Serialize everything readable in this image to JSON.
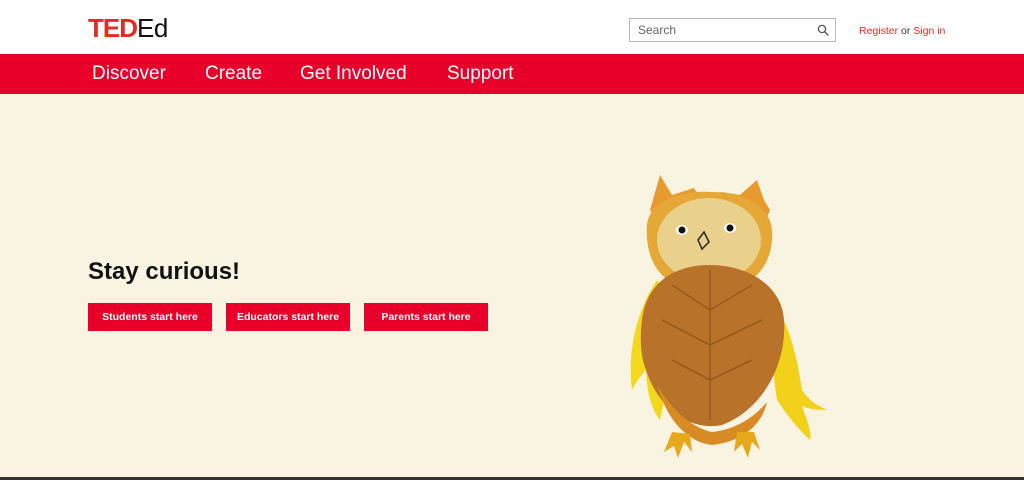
{
  "brand": {
    "logo_ted": "TED",
    "logo_ed": "Ed"
  },
  "header": {
    "search": {
      "placeholder": "Search"
    },
    "register_label": "Register",
    "or_text": "or",
    "signin_label": "Sign in"
  },
  "nav": {
    "items": [
      {
        "label": "Discover"
      },
      {
        "label": "Create"
      },
      {
        "label": "Get Involved"
      },
      {
        "label": "Support"
      }
    ]
  },
  "hero": {
    "title": "Stay curious!",
    "buttons": [
      {
        "label": "Students start here"
      },
      {
        "label": "Educators start here"
      },
      {
        "label": "Parents start here"
      }
    ],
    "illustration": "leaf-owl-illustration"
  },
  "colors": {
    "brand_red": "#e8002a",
    "hero_background": "#f9f4e2",
    "text_dark": "#111111"
  }
}
